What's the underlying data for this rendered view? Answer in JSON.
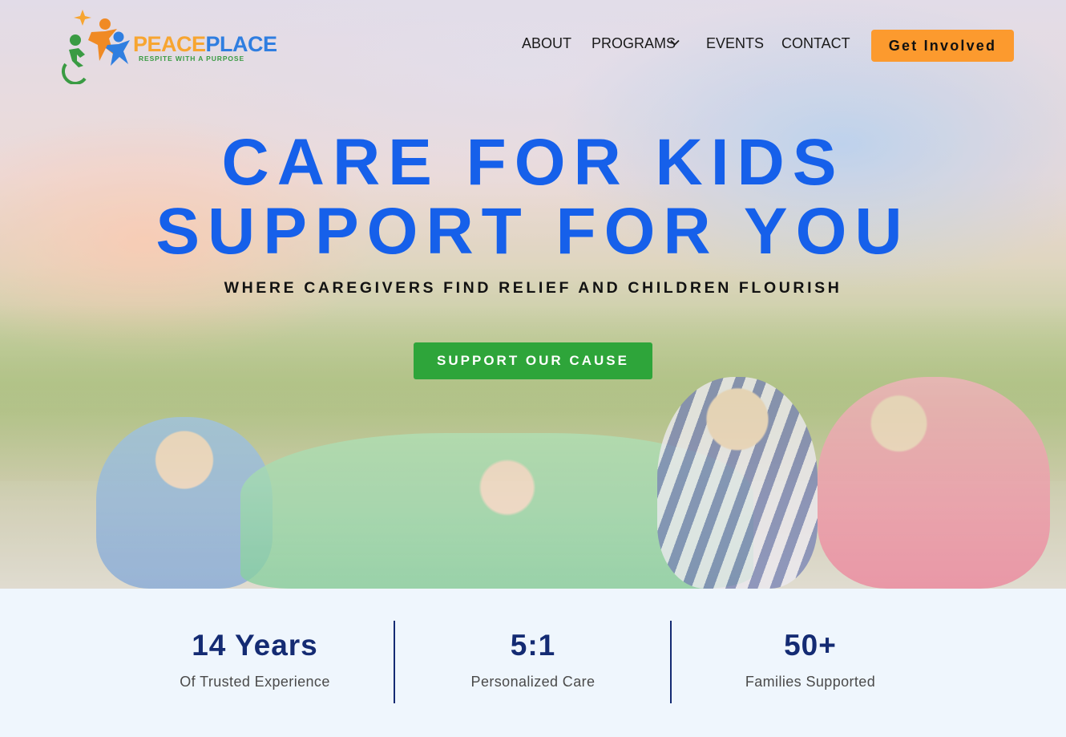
{
  "brand": {
    "name": "PEACEPLACE",
    "tagline": "RESPITE WITH A PURPOSE",
    "colors": {
      "orange": "#f7a531",
      "blue": "#2f7ee0",
      "green": "#3a9b43"
    }
  },
  "nav": {
    "items": [
      {
        "label": "ABOUT"
      },
      {
        "label": "PROGRAMS",
        "icon": "chevron-down-icon"
      },
      {
        "label": "EVENTS"
      },
      {
        "label": "CONTACT"
      }
    ],
    "cta_label": "Get Involved"
  },
  "hero": {
    "headline_line1": "CARE FOR KIDS",
    "headline_line2": "SUPPORT FOR YOU",
    "subheadline": "WHERE CAREGIVERS FIND RELIEF AND CHILDREN FLOURISH",
    "button_label": "SUPPORT OUR CAUSE"
  },
  "stats": [
    {
      "value": "14 Years",
      "label": "Of Trusted Experience"
    },
    {
      "value": "5:1",
      "label": "Personalized Care"
    },
    {
      "value": "50+",
      "label": "Families Supported"
    }
  ],
  "theme": {
    "headline_color": "#1660ea",
    "cta_color": "#fc9a2e",
    "button_color": "#2ea53a",
    "stat_color": "#142b73",
    "stats_background": "#eff6fd"
  }
}
